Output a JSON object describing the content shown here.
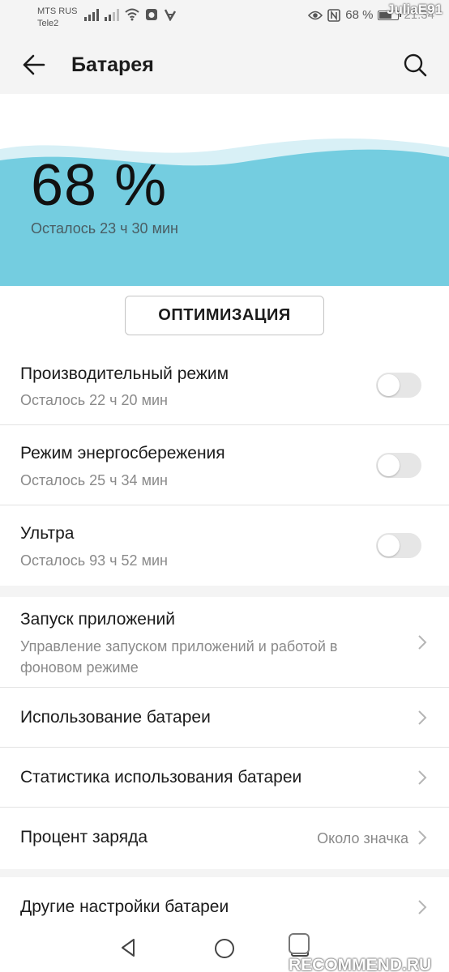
{
  "status_bar": {
    "carrier_1": "MTS RUS",
    "carrier_2": "Tele2",
    "battery_text": "68 %",
    "battery_level": 0.68,
    "time": "21:34",
    "icons": [
      "signal-icon",
      "signal-icon",
      "wifi-icon",
      "camera-icon",
      "app-icon",
      "eye-icon",
      "nfc-icon",
      "battery-icon"
    ],
    "watermark": "JuliaE91"
  },
  "header": {
    "title": "Батарея"
  },
  "battery": {
    "percent": "68 %",
    "remaining": "Осталось 23 ч 30 мин",
    "wave_color": "#74cde0"
  },
  "optimize": {
    "label": "ОПТИМИЗАЦИЯ"
  },
  "modes": [
    {
      "label": "Производительный режим",
      "sub": "Осталось 22 ч 20 мин",
      "enabled": false
    },
    {
      "label": "Режим энергосбережения",
      "sub": "Осталось 25 ч 34 мин",
      "enabled": false
    },
    {
      "label": "Ультра",
      "sub": "Осталось 93 ч 52 мин",
      "enabled": false
    }
  ],
  "settings": {
    "app_launch": {
      "label": "Запуск приложений",
      "sub_line_1": "Управление запуском приложений и работой в",
      "sub_line_2": "фоновом режиме"
    },
    "battery_usage": {
      "label": "Использование батареи"
    },
    "battery_stats": {
      "label": "Статистика использования батареи"
    },
    "charge_percent": {
      "label": "Процент заряда",
      "value": "Около значка"
    }
  },
  "other": {
    "label": "Другие настройки батареи"
  },
  "navigation": {
    "watermark": "RECOMMEND.RU"
  }
}
